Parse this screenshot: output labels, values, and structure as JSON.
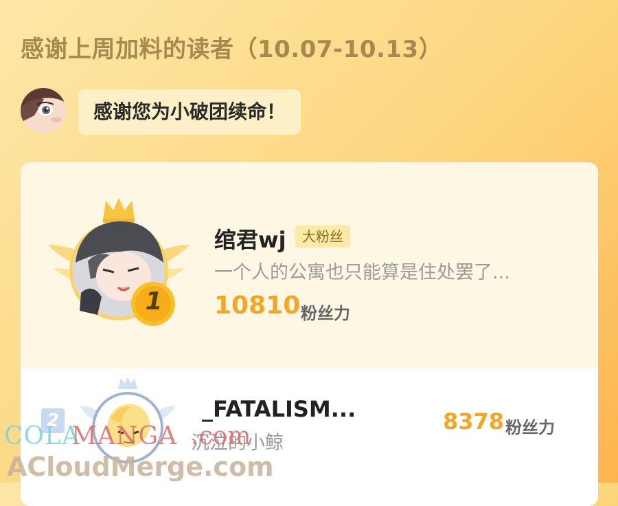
{
  "page": {
    "title": "感谢上周加料的读者（10.07-10.13）"
  },
  "host": {
    "message": "感谢您为小破团续命！"
  },
  "leaderboard": [
    {
      "rank": "1",
      "name": "绾君wj",
      "badge": "大粉丝",
      "signature": "一个人的公寓也只能算是住处罢了...",
      "power_value": "10810",
      "power_label": "粉丝力"
    },
    {
      "rank": "2",
      "name": "_FATALISM...",
      "signature": "沉泣的小鲸",
      "power_value": "8378",
      "power_label": "粉丝力"
    }
  ],
  "watermark": {
    "line1": "COLAMANGA.com",
    "line2": "ACloudMerge.com"
  },
  "colors": {
    "accent": "#f3a523",
    "background_light": "#fde7a8",
    "background_dark": "#fdb44e",
    "title": "#a7894f",
    "badge_bg": "#fbe9a6"
  }
}
